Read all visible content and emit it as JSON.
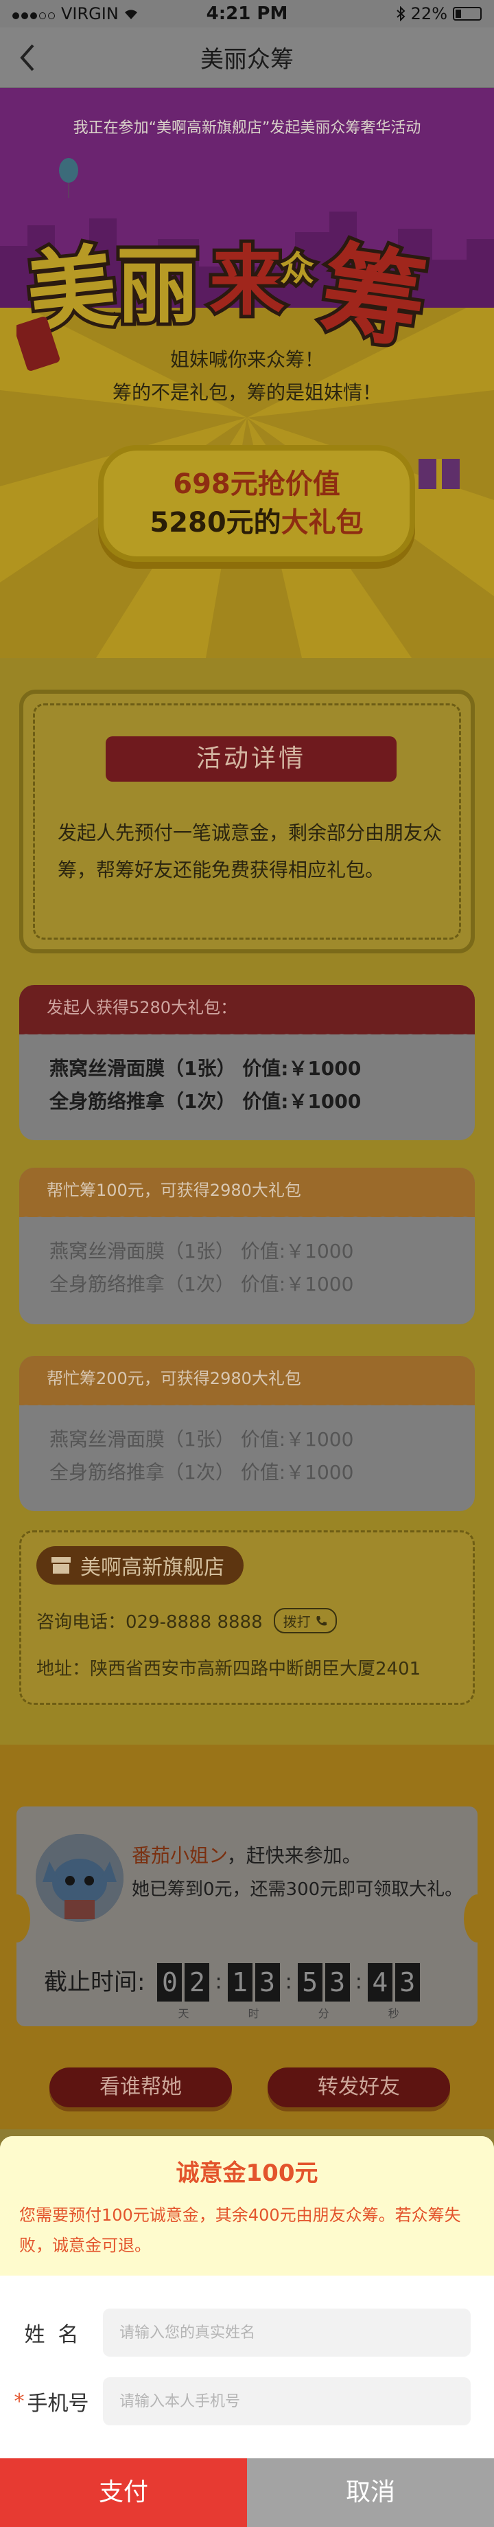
{
  "status_bar": {
    "carrier": "VIRGIN",
    "time": "4:21 PM",
    "battery": "22%"
  },
  "nav": {
    "title": "美丽众筹"
  },
  "hero": {
    "invite": "我正在参加“美啊高新旗舰店”发起美丽众筹奢华活动",
    "logo_text": [
      "美",
      "丽",
      "来",
      "众",
      "筹"
    ],
    "slogan_1": "姐妹喊你来众筹！",
    "slogan_2": "筹的不是礼包，筹的是姐妹情！",
    "price_line1": "698元抢价值",
    "price_line2_pre": "5280元的",
    "price_line2_em": "大礼包"
  },
  "detail": {
    "ribbon": "活动详情",
    "text": "发起人先预付一笔诚意金，剩余部分由朋友众筹，帮筹好友还能免费获得相应礼包。"
  },
  "cards": [
    {
      "header": "发起人获得5280大礼包：",
      "items": [
        "燕窝丝滑面膜（1张）  价值:￥1000",
        "全身筋络推拿（1次）  价值:￥1000"
      ]
    },
    {
      "header": "帮忙筹100元，可获得2980大礼包",
      "items": [
        "燕窝丝滑面膜（1张）  价值:￥1000",
        "全身筋络推拿（1次）  价值:￥1000"
      ]
    },
    {
      "header": "帮忙筹200元，可获得2980大礼包",
      "items": [
        "燕窝丝滑面膜（1张）  价值:￥1000",
        "全身筋络推拿（1次）  价值:￥1000"
      ]
    }
  ],
  "store": {
    "name": "美啊高新旗舰店",
    "phone": "咨询电话：029-8888 8888",
    "call_label": "拨打",
    "address": "地址：陕西省西安市高新四路中断朗臣大厦2401"
  },
  "initiator": {
    "name": "番茄小姐ン",
    "suffix": "，赶快来参加。",
    "progress": "她已筹到0元，还需300元即可领取大礼。"
  },
  "countdown": {
    "label": "截止时间:",
    "days": [
      "0",
      "2"
    ],
    "hours": [
      "1",
      "3"
    ],
    "minutes": [
      "5",
      "3"
    ],
    "seconds": [
      "4",
      "3"
    ],
    "units": [
      "天",
      "时",
      "分",
      "秒"
    ]
  },
  "actions": {
    "who_helped": "看谁帮她",
    "share": "转发好友"
  },
  "modal": {
    "title": "诚意金100元",
    "desc": "您需要预付100元诚意金，其余400元由朋友众筹。若众筹失败，诚意金可退。",
    "name_label": "姓  名",
    "name_placeholder": "请输入您的真实姓名",
    "phone_label": "手机号",
    "phone_required": "*",
    "phone_placeholder": "请输入本人手机号",
    "pay": "支付",
    "cancel": "取消"
  },
  "colors": {
    "accent_red": "#e73a32",
    "modal_text": "#e3542c",
    "overlay_gold": "#9a8525"
  }
}
